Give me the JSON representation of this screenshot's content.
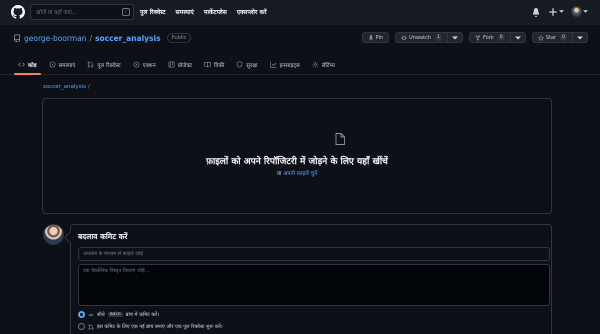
{
  "header": {
    "search_placeholder": "खोजें या यहाँ जाएं...",
    "search_hint": "/",
    "nav": [
      "पुल रिक्वेस्ट",
      "समस्याएं",
      "मार्केटप्लेस",
      "एक्सप्लोर करें"
    ]
  },
  "repo": {
    "owner": "george-boorman",
    "separator": "/",
    "name": "soccer_analysis",
    "visibility": "Public",
    "actions": {
      "pin_label": "Pin",
      "unwatch_label": "Unwatch",
      "unwatch_count": "1",
      "fork_label": "Fork",
      "fork_count": "0",
      "star_label": "Star",
      "star_count": "0"
    },
    "tabs": [
      {
        "label": "कोड",
        "icon": "code-icon"
      },
      {
        "label": "समस्याएं",
        "icon": "issue-icon"
      },
      {
        "label": "पुल रिक्वेस्ट",
        "icon": "pull-request-icon"
      },
      {
        "label": "एक्शन",
        "icon": "play-icon"
      },
      {
        "label": "प्रोजेक्ट",
        "icon": "table-icon"
      },
      {
        "label": "विकी",
        "icon": "book-icon"
      },
      {
        "label": "सुरक्षा",
        "icon": "shield-icon"
      },
      {
        "label": "इनसाइट्स",
        "icon": "graph-icon"
      },
      {
        "label": "सेटिंग्स",
        "icon": "gear-icon"
      }
    ]
  },
  "breadcrumb": {
    "repo": "soccer_analysis",
    "slash": "/"
  },
  "dropzone": {
    "title": "फ़ाइलों को अपने रिपॉजिटरी में जोड़ने के लिए यहाँ खींचें",
    "or_text": "या",
    "choose_link": "अपनी फ़ाइलें चुनें"
  },
  "commit": {
    "title": "बदलाव कमिट करें",
    "summary_placeholder": "अपलोड के माध्यम से फ़ाइलें जोड़ें",
    "description_placeholder": "एक वैकल्पिक विस्तृत विवरण जोड़ें...",
    "option_direct_prefix": "सीधे",
    "option_direct_branch": "main",
    "option_direct_suffix": "ब्रांच में कमिट करें।",
    "option_new_branch": "इस कमिट के लिए एक नई ब्रांच बनाएं और एक पुल रिक्वेस्ट शुरू करें।"
  },
  "colors": {
    "background": "#0d1117",
    "header": "#161b22",
    "link": "#58a6ff",
    "active_tab": "#f78166",
    "border": "#30363d"
  }
}
